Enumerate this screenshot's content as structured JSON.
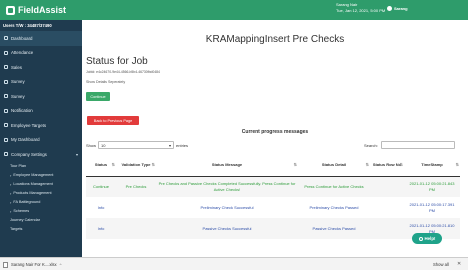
{
  "app": {
    "brand": "FieldAssist"
  },
  "header": {
    "user_line": "Sarang Nair",
    "datetime_line": "Tue, Jan 12, 2021, 5:00 PM",
    "user_name_right": "Sarang"
  },
  "sidebar": {
    "users_label": "Users T/W : 34487/37490",
    "items": [
      {
        "label": "Dashboard",
        "active": true
      },
      {
        "label": "Attendance"
      },
      {
        "label": "Sales"
      },
      {
        "label": "Survey"
      },
      {
        "label": "Survey"
      },
      {
        "label": "Notification"
      },
      {
        "label": "Employee Targets"
      },
      {
        "label": "My Dashboard"
      },
      {
        "label": "Company Settings",
        "has_chevron": true
      }
    ],
    "subitems": [
      "Tour Plan",
      "Employee Management",
      "Locations Management",
      "Products Management",
      "FA Battleground",
      "Schemes",
      "Journey Calendar",
      "Targets"
    ]
  },
  "main": {
    "page_heading": "KRAMappingInsert Pre Checks",
    "job_title": "Status for Job",
    "job_id": "JobId: e4c24670-9e44-4566-b5b4-46730fbd0484",
    "show_details": "Show Details Seperately",
    "continue_label": "Continue",
    "back_label": "Back to Previous Page",
    "progress_title": "Current progress messages",
    "show_label": "Show",
    "entries_value": "10",
    "entries_label": "entries",
    "search_label": "Search:"
  },
  "table": {
    "headers": [
      "Status",
      "Validation Type",
      "Status Message",
      "Status Detail",
      "Status Row No",
      "TimeStamp"
    ],
    "rows": [
      {
        "status": "Continue",
        "validation_type": "Pre Checks",
        "message": "Pre Checks and Passive Checks Completed Successfully. Press Continue for Active Checks!",
        "detail": "Press Continue for Active Checks",
        "row_no": "",
        "timestamp": "2021-01-12 05:00:21.843 PM"
      },
      {
        "status": "Info",
        "validation_type": "",
        "message": "Preliminary Check Successful",
        "detail": "Preliminary Checks Passed",
        "row_no": "",
        "timestamp": "2021-01-12 05:00:17.391 PM"
      },
      {
        "status": "Info",
        "validation_type": "",
        "message": "Passive Checks Successful",
        "detail": "Passive Checks Passed",
        "row_no": "",
        "timestamp": "2021-01-12 05:00:21.810 PM"
      }
    ]
  },
  "help": {
    "label": "Help!"
  },
  "downloads": {
    "file_label": "Sarang Nair For K....xlsx",
    "show_all": "Show all",
    "close": "✕"
  }
}
